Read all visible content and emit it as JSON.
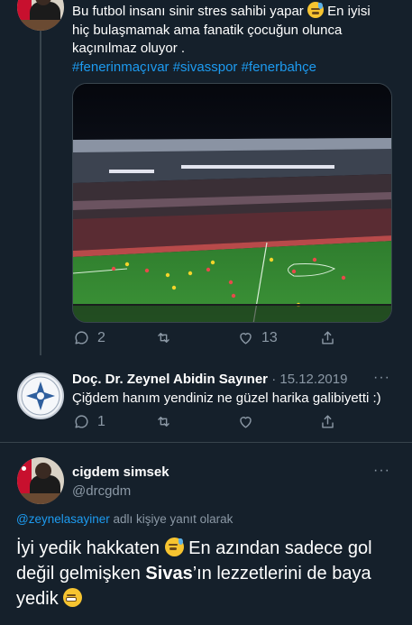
{
  "tweet1": {
    "text_a": "Bu futbol insanı sinir stres sahibi yapar",
    "text_b": "En iyisi hiç bulaşmamak ama fanatik çocuğun olunca kaçınılmaz oluyor .",
    "hashtags": "#fenerinmaçıvar #sivasspor #fenerbahçe",
    "replies": "2",
    "retweets": "",
    "likes": "13"
  },
  "tweet2": {
    "name": "Doç. Dr. Zeynel Abidin Sayıner",
    "separator": "·",
    "date": "15.12.2019",
    "text": "Çiğdem hanım yendiniz ne güzel harika galibiyetti :)",
    "replies": "1"
  },
  "main": {
    "name": "cigdem simsek",
    "handle": "@drcgdm",
    "reply_to_handle": "@zeynelasayiner",
    "reply_to_suffix": "adlı kişiye yanıt olarak",
    "text_a": "İyi yedik hakkaten",
    "text_b": "En azından sadece gol değil gelmişken",
    "text_bold": "Sivas",
    "text_c": "’ın lezzetlerini de baya yedik"
  },
  "more_label": "···",
  "colors": {
    "background": "#15202b",
    "accent": "#1d9bf0",
    "muted": "#8b98a5",
    "border": "#38444d"
  },
  "icons": [
    "reply-icon",
    "retweet-icon",
    "like-icon",
    "share-icon",
    "more-icon",
    "downcast-sweat-emoji",
    "grimace-emoji"
  ]
}
